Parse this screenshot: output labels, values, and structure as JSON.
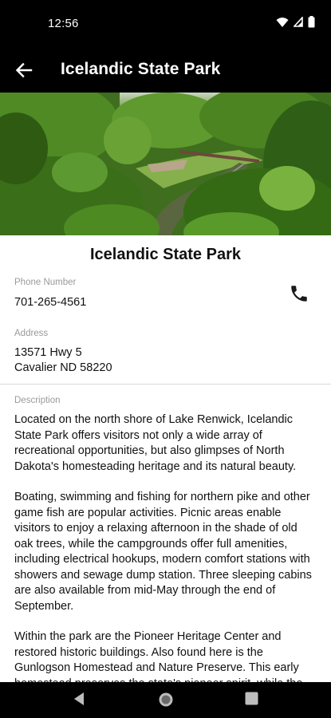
{
  "status_bar": {
    "time": "12:56",
    "icons": [
      "wifi-icon",
      "cellular-signal-icon",
      "battery-icon"
    ]
  },
  "app_bar": {
    "title": "Icelandic State Park",
    "back_icon": "arrow-back-icon"
  },
  "park": {
    "name": "Icelandic State Park",
    "phone_label": "Phone Number",
    "phone": "701-265-4561",
    "phone_icon": "phone-icon",
    "address_label": "Address",
    "address_line1": "13571 Hwy 5",
    "address_line2": "Cavalier ND 58220",
    "description_label": "Description",
    "description": [
      "Located on the north shore of Lake Renwick, Icelandic State Park offers visitors not only a wide array of recreational opportunities, but also glimpses of North Dakota's homesteading heritage and its natural beauty.",
      "Boating, swimming and fishing for northern pike and other game fish are popular activities. Picnic areas enable visitors to enjoy a relaxing afternoon in the shade of old oak trees, while the campgrounds offer full amenities, including electrical hookups, modern comfort stations with showers and sewage dump station. Three sleeping cabins are also available from mid-May through the end of September.",
      "Within the park are the Pioneer Heritage Center and restored historic buildings. Also found here is the Gunlogson Homestead and Nature Preserve. This early homestead preserves the state's pioneer spirit, while the 200-acre natural wooded area along the Tongue River is"
    ]
  },
  "nav_bar": {
    "icons": [
      "back-triangle-icon",
      "home-circle-icon",
      "recents-square-icon"
    ]
  },
  "colors": {
    "bar_background": "#000000",
    "label_gray": "#9a9a9a",
    "text": "#111111"
  }
}
